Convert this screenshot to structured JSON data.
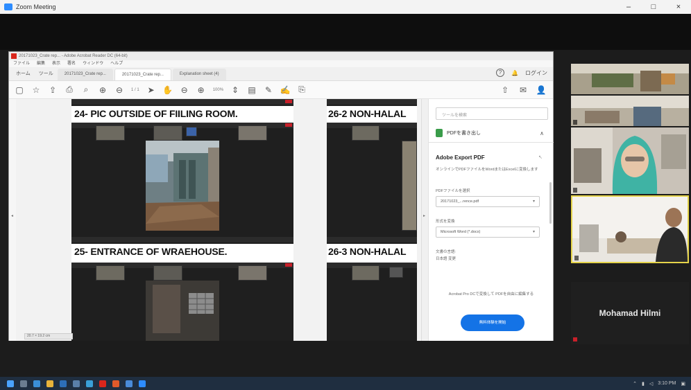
{
  "window": {
    "title": "Zoom Meeting",
    "controls": [
      "–",
      "□",
      "×"
    ]
  },
  "acrobat": {
    "title_bar": "20171023_Crate rep... - Adobe Acrobat Reader DC (64-bit)",
    "menu": [
      "ファイル",
      "編集",
      "表示",
      "署名",
      "ウィンドウ",
      "ヘルプ"
    ],
    "home_tab": "ホーム",
    "tools_tab": "ツール",
    "tabs": [
      "20171023_Crate rep...",
      "20171023_Crate rep...",
      "Explanation sheet (4)"
    ],
    "active_tab_index": 1,
    "sign_in": "ログイン",
    "help": "?",
    "zoom_level": "100%",
    "page_indicator": "20.7 × 19.2 cm"
  },
  "document": {
    "left_col": {
      "heading_top": "24- PIC OUTSIDE OF FIILING ROOM.",
      "heading_bottom": "25- ENTRANCE OF WRAEHOUSE."
    },
    "right_col": {
      "heading_top": "26-2 NON-HALAL",
      "heading_bottom": "26-3 NON-HALAL"
    }
  },
  "right_panel": {
    "search_placeholder": "ツールを検索",
    "section": "PDFを書き出し",
    "section_chevron": "∧",
    "title": "Adobe Export PDF",
    "title_icon": "↖",
    "description": "オンラインでPDFファイルをWordまたはExcelに変換します",
    "label_file": "PDFファイルを選択",
    "file_value": "20171023_...rence.pdf",
    "label_format": "形式を変換",
    "format_value": "Microsoft Word (*.docx)",
    "label_lang": "文書の言語:",
    "lang_value": "日本語 変更",
    "bottom_text": "Acrobat Pro DCで変換して PDFを自由に編集する",
    "button_label": "無料体験を開始"
  },
  "participants": [
    {
      "name": "",
      "tag": ""
    },
    {
      "name": "",
      "tag": ""
    },
    {
      "name": "",
      "tag": ""
    },
    {
      "name": "",
      "tag": ""
    }
  ],
  "active_speaker_name": "Mohamad Hilmi",
  "taskbar": {
    "time": "3:10 PM"
  },
  "colors": {
    "acrobat_blue": "#1473e6",
    "active_tile_border": "#e5d44a",
    "recording_red": "#c8202a"
  }
}
